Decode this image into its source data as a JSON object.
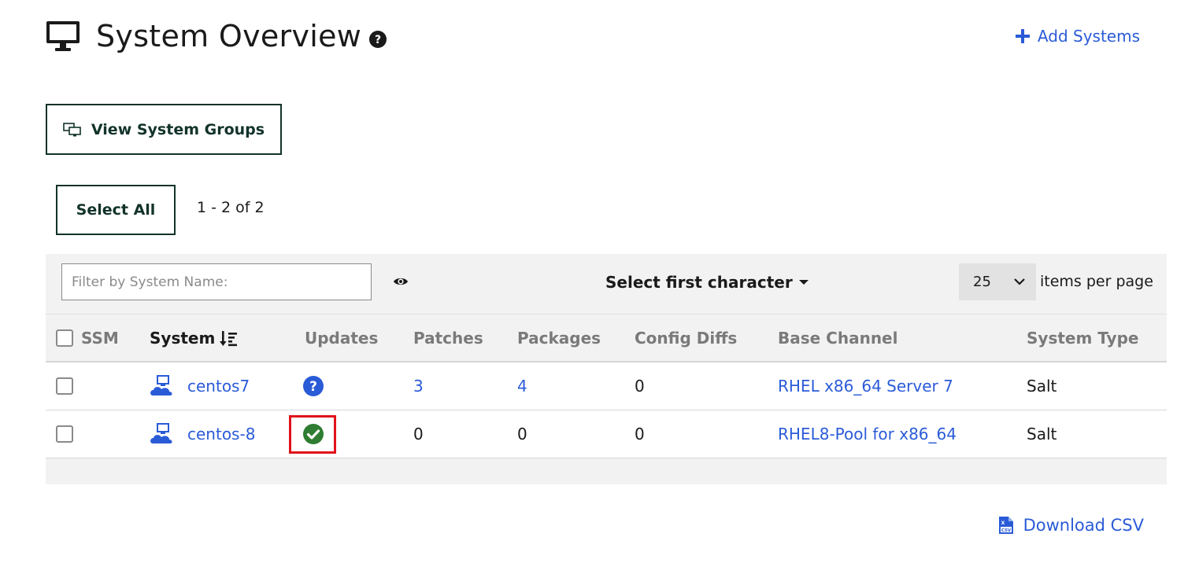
{
  "header": {
    "title": "System Overview",
    "add_systems_label": "Add Systems"
  },
  "actions": {
    "view_groups_label": "View System Groups",
    "select_all_label": "Select All",
    "count_text": "1 - 2 of 2"
  },
  "toolbar": {
    "filter_placeholder": "Filter by System Name:",
    "first_char_label": "Select first character",
    "per_page_value": "25",
    "per_page_label": "items per page"
  },
  "columns": {
    "ssm": "SSM",
    "system": "System",
    "updates": "Updates",
    "patches": "Patches",
    "packages": "Packages",
    "config_diffs": "Config Diffs",
    "base_channel": "Base Channel",
    "system_type": "System Type"
  },
  "rows": [
    {
      "system": "centos7",
      "updates_status": "unknown",
      "patches": "3",
      "packages": "4",
      "config_diffs": "0",
      "base_channel": "RHEL x86_64 Server 7",
      "system_type": "Salt"
    },
    {
      "system": "centos-8",
      "updates_status": "up-to-date",
      "patches": "0",
      "packages": "0",
      "config_diffs": "0",
      "base_channel": "RHEL8-Pool for x86_64",
      "system_type": "Salt"
    }
  ],
  "footer": {
    "download_label": "Download CSV"
  },
  "colors": {
    "link": "#2a5bd7",
    "button_border": "#12332a",
    "success": "#2e7d32",
    "highlight": "#e0121a"
  },
  "icons": [
    "monitor-icon",
    "help-icon",
    "plus-icon",
    "system-groups-icon",
    "eye-icon",
    "caret-down-icon",
    "chevron-down-icon",
    "sort-descending-icon",
    "system-cloud-icon",
    "question-circle-icon",
    "check-circle-icon",
    "csv-file-icon"
  ]
}
